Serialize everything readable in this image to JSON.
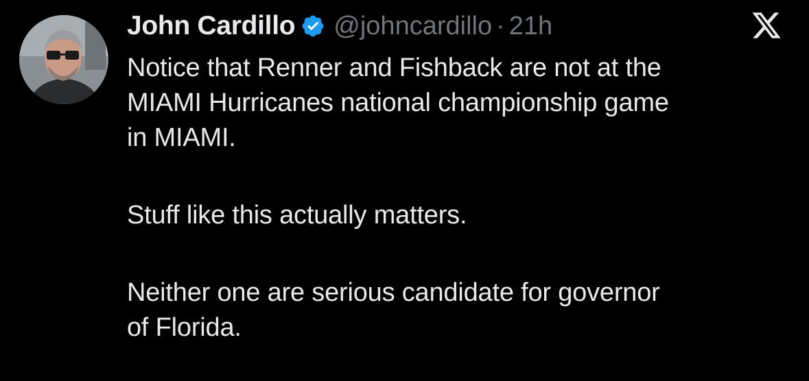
{
  "tweet": {
    "author": {
      "display_name": "John Cardillo",
      "handle": "@johncardillo",
      "verified": true,
      "avatar_icon": "profile-photo"
    },
    "separator": "·",
    "time": "21h",
    "platform_icon": "x-logo-icon",
    "text_lines": [
      "Notice that Renner and Fishback are not at the",
      "MIAMI Hurricanes national championship game",
      "in MIAMI.",
      "Stuff like this actually matters.",
      "Neither one are serious candidate for governor",
      "of Florida."
    ]
  },
  "colors": {
    "background": "#000000",
    "primary_text": "#e7e9ea",
    "secondary_text": "#71767b",
    "verified_badge": "#1d9bf0"
  }
}
